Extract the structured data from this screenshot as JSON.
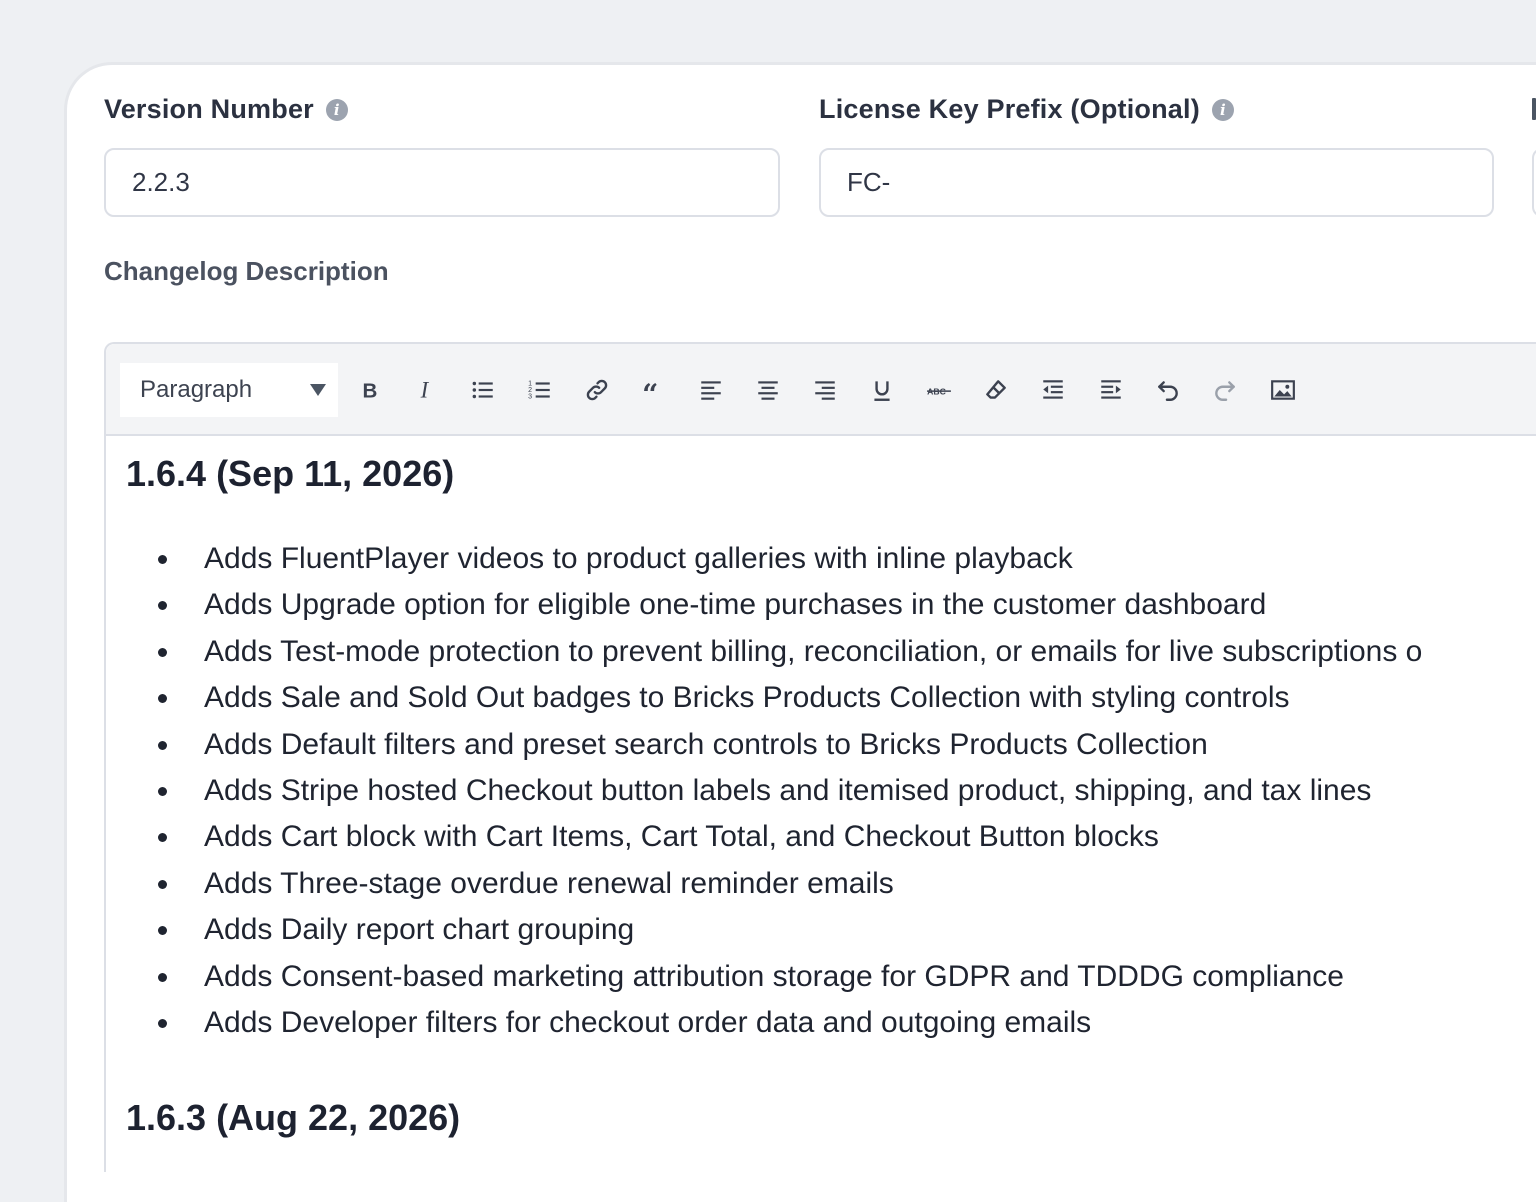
{
  "fields": {
    "version": {
      "label": "Version Number",
      "value": "2.2.3"
    },
    "license": {
      "label": "License Key Prefix (Optional)",
      "value": "FC-"
    }
  },
  "changelog": {
    "label": "Changelog Description",
    "toolbar": {
      "format_value": "Paragraph",
      "buttons": [
        "bold-icon",
        "italic-icon",
        "bullet-list-icon",
        "numbered-list-icon",
        "link-icon",
        "blockquote-icon",
        "align-left-icon",
        "align-center-icon",
        "align-right-icon",
        "underline-icon",
        "strikethrough-icon",
        "clear-formatting-icon",
        "outdent-icon",
        "indent-icon",
        "undo-icon",
        "redo-icon",
        "image-icon"
      ]
    },
    "releases": [
      {
        "heading": "1.6.4 (Sep 11, 2026)",
        "items": [
          "Adds FluentPlayer videos to product galleries with inline playback",
          "Adds Upgrade option for eligible one-time purchases in the customer dashboard",
          "Adds Test-mode protection to prevent billing, reconciliation, or emails for live subscriptions o",
          "Adds Sale and Sold Out badges to Bricks Products Collection with styling controls",
          "Adds Default filters and preset search controls to Bricks Products Collection",
          "Adds Stripe hosted Checkout button labels and itemised product, shipping, and tax lines",
          "Adds Cart block with Cart Items, Cart Total, and Checkout Button blocks",
          "Adds Three-stage overdue renewal reminder emails",
          "Adds Daily report chart grouping",
          "Adds Consent-based marketing attribution storage for GDPR and TDDDG compliance",
          "Adds Developer filters for checkout order data and outgoing emails"
        ]
      },
      {
        "heading": "1.6.3 (Aug 22, 2026)",
        "items": []
      }
    ]
  }
}
